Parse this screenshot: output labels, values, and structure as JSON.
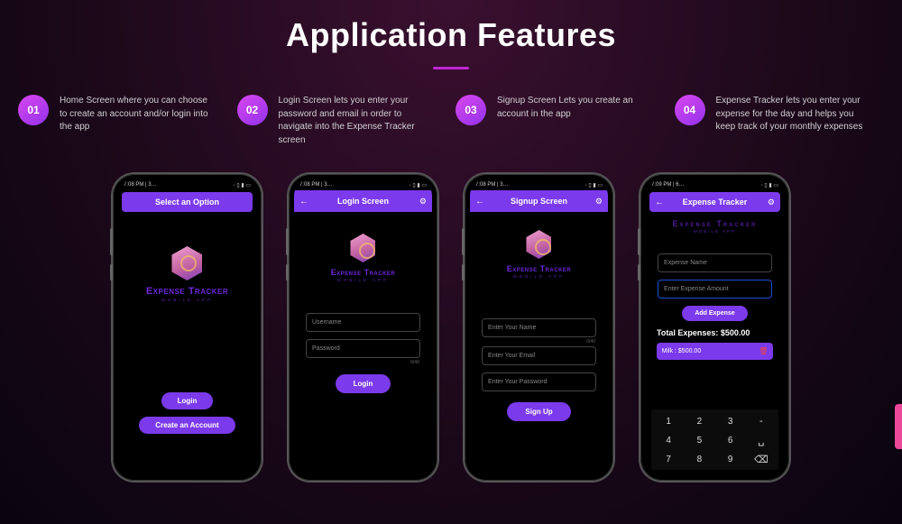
{
  "page": {
    "title": "Application Features"
  },
  "features": [
    {
      "num": "01",
      "text": "Home Screen where you can choose to create an account and/or login into the app"
    },
    {
      "num": "02",
      "text": "Login Screen lets you enter your password and email in order to navigate into the Expense Tracker screen"
    },
    {
      "num": "03",
      "text": "Signup Screen Lets you create an account in the app"
    },
    {
      "num": "04",
      "text": "Expense Tracker lets you enter your expense for the day and helps you keep track of your monthly expenses"
    }
  ],
  "logo": {
    "title": "Expense Tracker",
    "subtitle": "MOBILE APP"
  },
  "phone1": {
    "status_time": "7:08 PM | 3…",
    "header": "Select an Option",
    "login": "Login",
    "create": "Create an Account"
  },
  "phone2": {
    "status_time": "7:08 PM | 3…",
    "header": "Login Screen",
    "user_ph": "Username",
    "pass_ph": "Password",
    "counter": "0/40",
    "login": "Login"
  },
  "phone3": {
    "status_time": "7:08 PM | 3…",
    "header": "Signup Screen",
    "name_ph": "Enter Your Name",
    "name_counter": "0/40",
    "email_ph": "Enter Your Email",
    "pass_ph": "Enter Your Password",
    "signup": "Sign Up"
  },
  "phone4": {
    "status_time": "7:09 PM | 6…",
    "header": "Expense Tracker",
    "exp_name_ph": "Expense Name",
    "exp_amt_ph": "Enter Expense Amount",
    "add": "Add Expense",
    "total": "Total Expenses: $500.00",
    "item": "Milk : $500.00",
    "keys": {
      "r1": [
        "1",
        "2",
        "3",
        "-"
      ],
      "r2": [
        "4",
        "5",
        "6",
        "␣"
      ],
      "r3": [
        "7",
        "8",
        "9",
        "⌫"
      ]
    }
  }
}
